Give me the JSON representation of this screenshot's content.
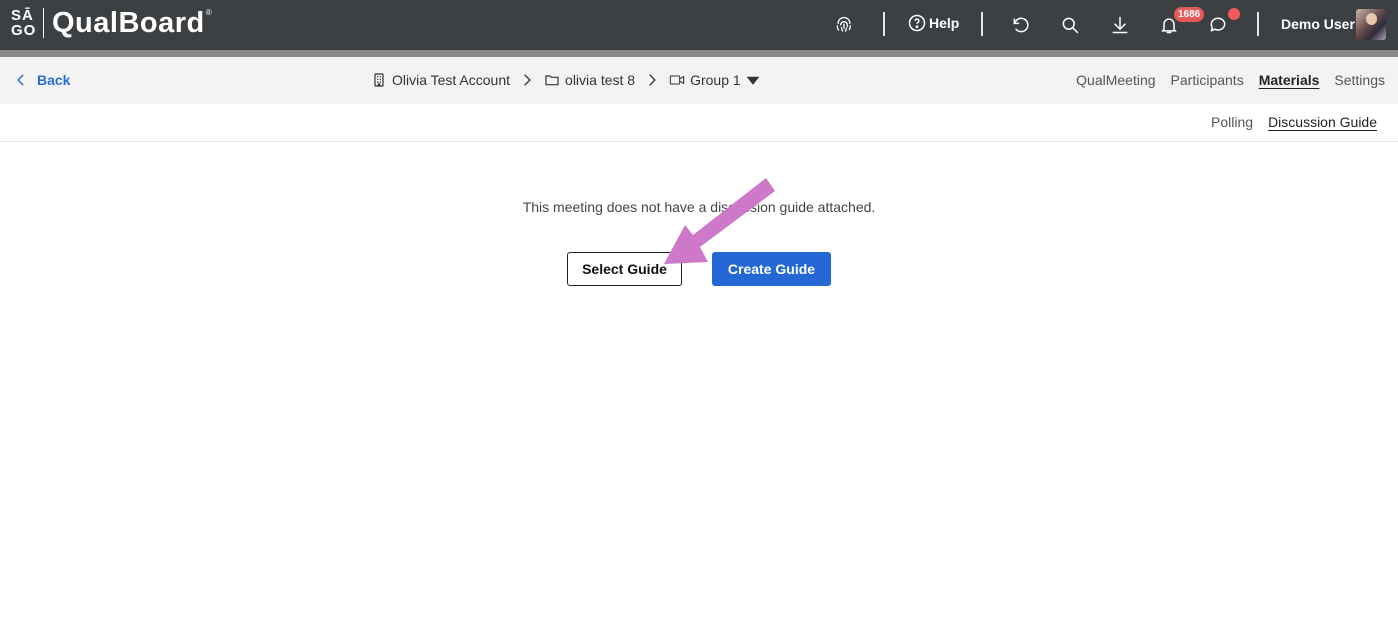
{
  "header": {
    "logo_mark_top": "SĀ",
    "logo_mark_bottom": "GO",
    "logo_text": "QualBoard",
    "logo_reg": "®",
    "help_label": "Help",
    "notification_count": "1686",
    "user_name": "Demo User",
    "icons": [
      "fingerprint-icon",
      "help-icon",
      "undo-icon",
      "search-icon",
      "download-icon",
      "bell-icon",
      "chat-icon"
    ]
  },
  "subbar": {
    "back_label": "Back",
    "breadcrumbs": [
      {
        "label": "Olivia Test Account",
        "icon": "building-icon"
      },
      {
        "label": "olivia test 8",
        "icon": "folder-icon"
      },
      {
        "label": "Group 1",
        "icon": "video-icon"
      }
    ],
    "nav_tabs": [
      {
        "label": "QualMeeting",
        "active": false
      },
      {
        "label": "Participants",
        "active": false
      },
      {
        "label": "Materials",
        "active": true
      },
      {
        "label": "Settings",
        "active": false
      }
    ]
  },
  "subtabs": [
    {
      "label": "Polling",
      "active": false
    },
    {
      "label": "Discussion Guide",
      "active": true
    }
  ],
  "main": {
    "message": "This meeting does not have a discussion guide attached.",
    "select_button": "Select Guide",
    "create_button": "Create Guide"
  },
  "colors": {
    "topbar": "#3c4043",
    "accent": "#2468d6",
    "badge": "#e65a5a",
    "annotation_arrow": "#cd78c8"
  }
}
